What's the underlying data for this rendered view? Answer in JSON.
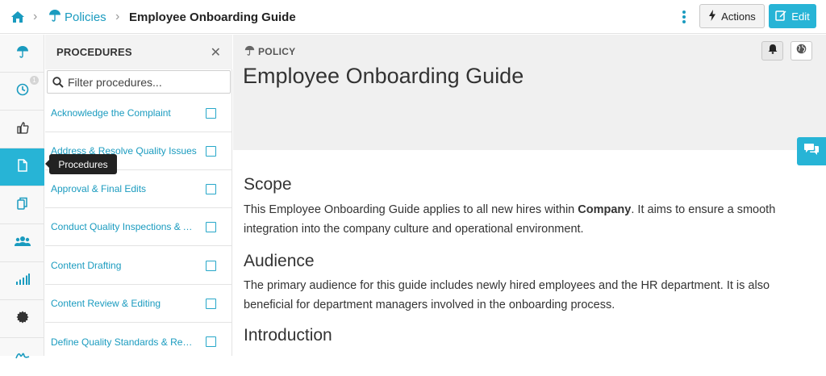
{
  "breadcrumb": {
    "home_icon": "home-icon",
    "separator": "›",
    "policies_label": "Policies",
    "current": "Employee Onboarding Guide"
  },
  "header": {
    "actions_label": "Actions",
    "edit_label": "Edit"
  },
  "rail": {
    "items": [
      {
        "icon": "umbrella-icon"
      },
      {
        "icon": "clock-icon",
        "badge": "1"
      },
      {
        "icon": "thumbs-up-icon"
      },
      {
        "icon": "document-icon",
        "active": true
      },
      {
        "icon": "copy-icon"
      },
      {
        "icon": "users-icon"
      },
      {
        "icon": "signal-bars-icon"
      },
      {
        "icon": "badge-seal-icon"
      },
      {
        "icon": "signature-icon"
      }
    ],
    "tooltip": "Procedures"
  },
  "panel": {
    "title": "PROCEDURES",
    "filter_placeholder": "Filter procedures...",
    "items": [
      {
        "label": "Acknowledge the Complaint"
      },
      {
        "label": "Address & Resolve Quality Issues"
      },
      {
        "label": "Approval & Final Edits"
      },
      {
        "label": "Conduct Quality Inspections & Audits"
      },
      {
        "label": "Content Drafting"
      },
      {
        "label": "Content Review & Editing"
      },
      {
        "label": "Define Quality Standards & Requirements"
      }
    ]
  },
  "hero": {
    "kicker": "POLICY",
    "title": "Employee Onboarding Guide"
  },
  "content": {
    "scope_heading": "Scope",
    "scope_text_1": "This Employee Onboarding Guide applies to all new hires within ",
    "scope_text_bold": "Company",
    "scope_text_2": ". It aims to ensure a smooth integration into the company culture and operational environment.",
    "audience_heading": "Audience",
    "audience_text": "The primary audience for this guide includes newly hired employees and the HR department. It is also beneficial for department managers involved in the onboarding process.",
    "intro_heading": "Introduction"
  },
  "colors": {
    "accent": "#27b4d6",
    "link": "#1a9bbf",
    "hero_bg": "#f0f0f0"
  }
}
